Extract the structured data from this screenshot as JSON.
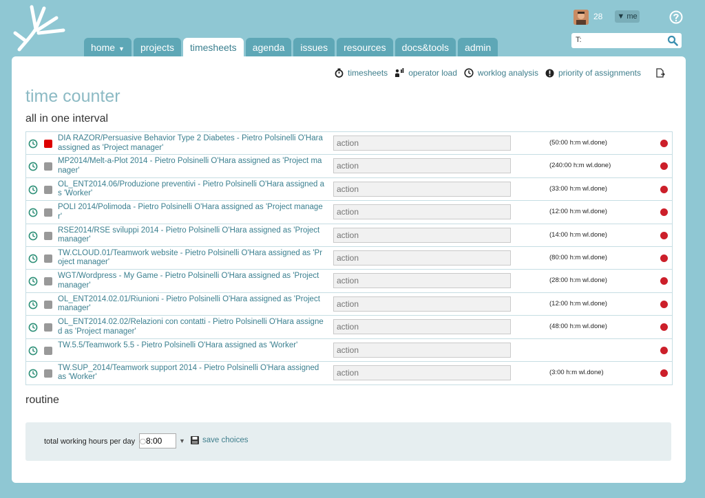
{
  "header": {
    "user_count": "28",
    "user_menu_label": "▼ me",
    "search_value": "T:"
  },
  "nav": {
    "tabs": [
      {
        "label": "home",
        "caret": "▼"
      },
      {
        "label": "projects"
      },
      {
        "label": "timesheets"
      },
      {
        "label": "agenda"
      },
      {
        "label": "issues"
      },
      {
        "label": "resources"
      },
      {
        "label": "docs&tools"
      },
      {
        "label": "admin"
      }
    ],
    "active_tab": "timesheets"
  },
  "toolbar": {
    "items": [
      {
        "label": "timesheets",
        "icon": "stopwatch-icon"
      },
      {
        "label": "operator load",
        "icon": "operator-load-icon"
      },
      {
        "label": "worklog analysis",
        "icon": "clock-icon"
      },
      {
        "label": "priority of assignments",
        "icon": "exclamation-icon"
      }
    ],
    "export_icon": "export-icon"
  },
  "page": {
    "title": "time counter",
    "section_title": "all in one interval",
    "routine_title": "routine"
  },
  "assignments": [
    {
      "text": "DIA RAZOR/Persuasive Behavior Type 2 Diabetes - Pietro Polsinelli O'Hara assigned as 'Project manager'",
      "placeholder": "action",
      "done": "(50:00 h:m wl.done)",
      "running": true
    },
    {
      "text": "MP2014/Melt-a-Plot 2014 - Pietro Polsinelli O'Hara assigned as 'Project manager'",
      "placeholder": "action",
      "done": "(240:00 h:m wl.done)",
      "running": false
    },
    {
      "text": "OL_ENT2014.06/Produzione preventivi - Pietro Polsinelli O'Hara assigned as 'Worker'",
      "placeholder": "action",
      "done": "(33:00 h:m wl.done)",
      "running": false
    },
    {
      "text": "POLI 2014/Polimoda - Pietro Polsinelli O'Hara assigned as 'Project manager'",
      "placeholder": "action",
      "done": "(12:00 h:m wl.done)",
      "running": false
    },
    {
      "text": "RSE2014/RSE sviluppi 2014 - Pietro Polsinelli O'Hara assigned as 'Project manager'",
      "placeholder": "action",
      "done": "(14:00 h:m wl.done)",
      "running": false
    },
    {
      "text": "TW.CLOUD.01/Teamwork website - Pietro Polsinelli O'Hara assigned as 'Project manager'",
      "placeholder": "action",
      "done": "(80:00 h:m wl.done)",
      "running": false
    },
    {
      "text": "WGT/Wordpress - My Game - Pietro Polsinelli O'Hara assigned as 'Project manager'",
      "placeholder": "action",
      "done": "(28:00 h:m wl.done)",
      "running": false
    },
    {
      "text": "OL_ENT2014.02.01/Riunioni - Pietro Polsinelli O'Hara assigned as 'Project manager'",
      "placeholder": "action",
      "done": "(12:00 h:m wl.done)",
      "running": false
    },
    {
      "text": "OL_ENT2014.02.02/Relazioni con contatti - Pietro Polsinelli O'Hara assigned as 'Project manager'",
      "placeholder": "action",
      "done": "(48:00 h:m wl.done)",
      "running": false
    },
    {
      "text": "TW.5.5/Teamwork 5.5 - Pietro Polsinelli O'Hara assigned as 'Worker'",
      "placeholder": "action",
      "done": "",
      "running": false
    },
    {
      "text": "TW.SUP_2014/Teamwork support 2014 - Pietro Polsinelli O'Hara assigned as 'Worker'",
      "placeholder": "action",
      "done": "(3:00 h:m wl.done)",
      "running": false
    }
  ],
  "routine": {
    "hours_label": "total working hours per day",
    "hours_value": "8:00",
    "save_label": "save choices"
  },
  "colors": {
    "background": "#8fc7d3",
    "tab": "#5ea7b6",
    "accent_text": "#3a7f8f",
    "running_square": "#dd0000",
    "stop_dot": "#cc1f2a"
  }
}
